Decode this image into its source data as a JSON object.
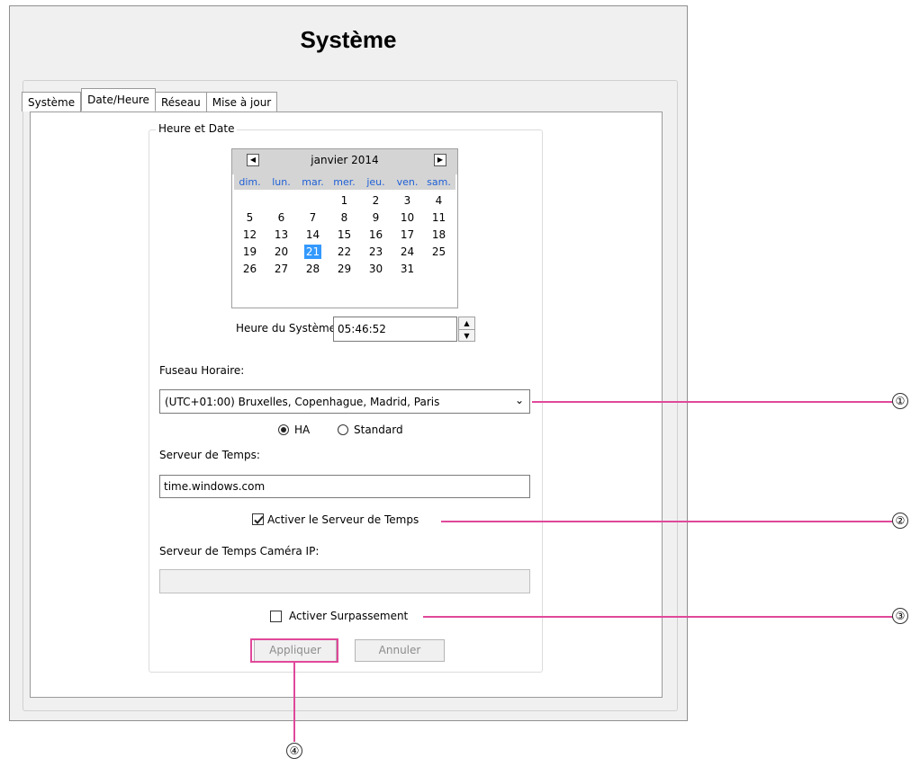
{
  "window": {
    "title": "Système"
  },
  "tabs": [
    {
      "label": "Système",
      "active": false
    },
    {
      "label": "Date/Heure",
      "active": true
    },
    {
      "label": "Réseau",
      "active": false
    },
    {
      "label": "Mise à jour",
      "active": false
    }
  ],
  "group": {
    "legend": "Heure et Date"
  },
  "calendar": {
    "prev_icon": "left-arrow",
    "next_icon": "right-arrow",
    "month_label": "janvier 2014",
    "days_of_week": [
      "dim.",
      "lun.",
      "mar.",
      "mer.",
      "jeu.",
      "ven.",
      "sam."
    ],
    "weeks": [
      [
        "",
        "",
        "",
        "1",
        "2",
        "3",
        "4"
      ],
      [
        "5",
        "6",
        "7",
        "8",
        "9",
        "10",
        "11"
      ],
      [
        "12",
        "13",
        "14",
        "15",
        "16",
        "17",
        "18"
      ],
      [
        "19",
        "20",
        "21",
        "22",
        "23",
        "24",
        "25"
      ],
      [
        "26",
        "27",
        "28",
        "29",
        "30",
        "31",
        ""
      ]
    ],
    "selected_day": "21",
    "selection_color": "#3399ff",
    "header_color": "#d4d4d4",
    "dow_color": "#1e5fd7"
  },
  "system_time": {
    "label": "Heure du Système:",
    "value": "05:46:52"
  },
  "timezone": {
    "label": "Fuseau Horaire:",
    "selected": "(UTC+01:00) Bruxelles, Copenhague, Madrid, Paris"
  },
  "dst": {
    "option_ha": "HA",
    "option_standard": "Standard",
    "selected": "HA"
  },
  "time_server": {
    "label": "Serveur de Temps:",
    "value": "time.windows.com",
    "enable_label": "Activer le Serveur de Temps",
    "enabled": true
  },
  "ip_camera_time_server": {
    "label": "Serveur de Temps Caméra IP:",
    "value": ""
  },
  "override": {
    "label": "Activer Surpassement",
    "enabled": false
  },
  "buttons": {
    "apply": "Appliquer",
    "cancel": "Annuler"
  },
  "callouts": {
    "one": "①",
    "two": "②",
    "three": "③",
    "four": "④",
    "color": "#e0489a"
  }
}
